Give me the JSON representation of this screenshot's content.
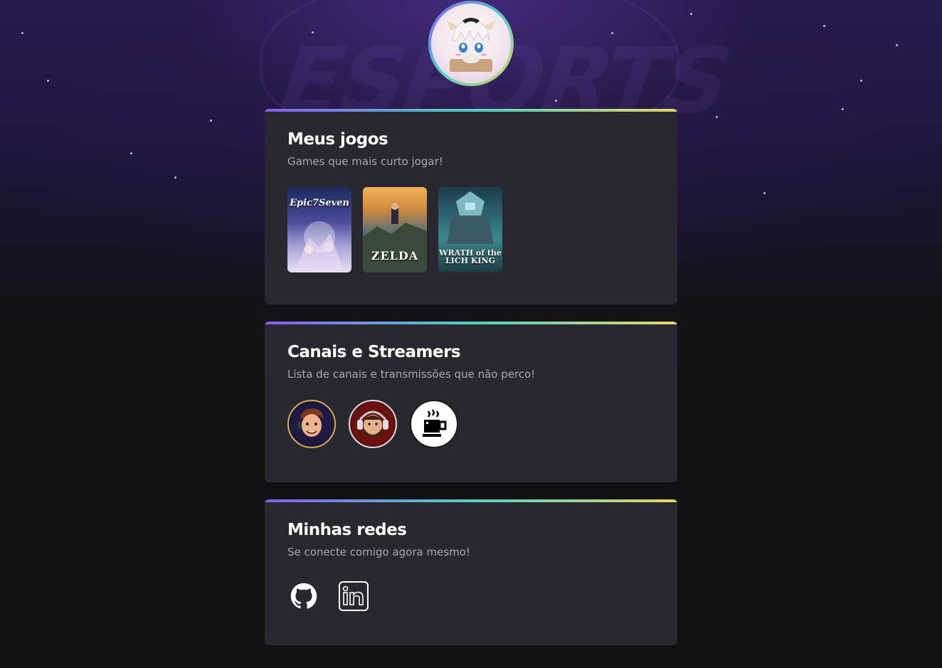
{
  "profile": {
    "avatar_alt": "profile-avatar",
    "background_text": "ESPORTS"
  },
  "games_section": {
    "title": "Meus jogos",
    "subtitle": "Games que mais curto jogar!",
    "games": [
      {
        "name": "Epic Seven",
        "label": "Epic7Seven"
      },
      {
        "name": "The Legend of Zelda: Breath of the Wild",
        "label": "ZELDA"
      },
      {
        "name": "World of Warcraft: Wrath of the Lich King Classic",
        "label": "WRATH of the LICH KING"
      }
    ]
  },
  "streamers_section": {
    "title": "Canais e Streamers",
    "subtitle": "Lista de canais e transmissões que não perco!",
    "streamers": [
      {
        "icon": "streamer-avatar-headset"
      },
      {
        "icon": "streamer-avatar-bearded"
      },
      {
        "icon": "coffee-cup-icon"
      }
    ]
  },
  "social_section": {
    "title": "Minhas redes",
    "subtitle": "Se conecte comigo agora mesmo!",
    "links": [
      {
        "icon": "github-icon"
      },
      {
        "icon": "linkedin-icon"
      }
    ]
  },
  "colors": {
    "gradient": [
      "#8b5cf6",
      "#4fd1c5",
      "#e6d766"
    ],
    "card_bg": "#29272f",
    "page_bg": "#121214"
  }
}
